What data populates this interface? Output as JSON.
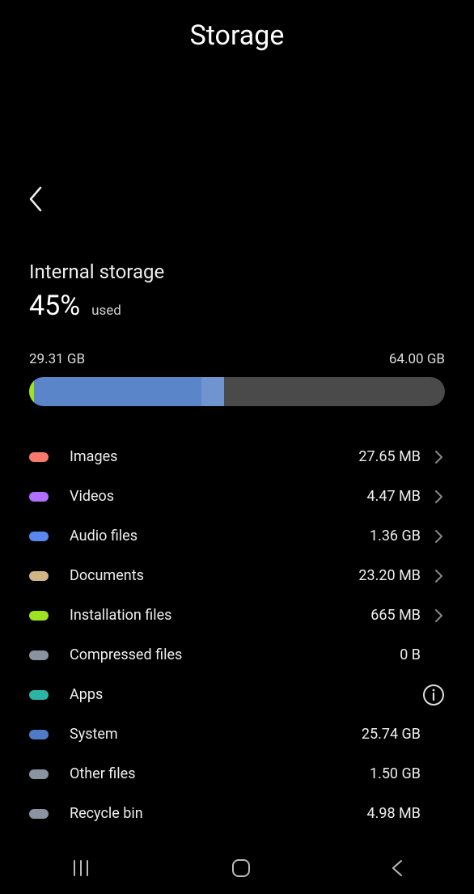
{
  "header": {
    "title": "Storage"
  },
  "storage": {
    "section_title": "Internal storage",
    "percent_value": "45%",
    "percent_label": "used",
    "used_size": "29.31 GB",
    "total_size": "64.00 GB",
    "used_percent": 45.8
  },
  "categories": [
    {
      "id": "images",
      "label": "Images",
      "size": "27.65 MB",
      "color": "#f77a6b",
      "bar_percent": 0.04,
      "chevron": true
    },
    {
      "id": "videos",
      "label": "Videos",
      "size": "4.47 MB",
      "color": "#b46eff",
      "bar_percent": 0.007,
      "chevron": true
    },
    {
      "id": "audio-files",
      "label": "Audio files",
      "size": "1.36 GB",
      "color": "#5a86f0",
      "bar_percent": 2.13,
      "chevron": true
    },
    {
      "id": "documents",
      "label": "Documents",
      "size": "23.20 MB",
      "color": "#d2b584",
      "bar_percent": 0.04,
      "chevron": true
    },
    {
      "id": "installation-files",
      "label": "Installation files",
      "size": "665 MB",
      "color": "#9fe221",
      "bar_percent": 1.04,
      "chevron": true
    },
    {
      "id": "compressed-files",
      "label": "Compressed files",
      "size": "0 B",
      "color": "#8a94a0",
      "bar_percent": 0,
      "chevron": false
    },
    {
      "id": "apps",
      "label": "Apps",
      "size": "",
      "color": "#2bb3a3",
      "bar_percent": 0,
      "info": true
    },
    {
      "id": "system",
      "label": "System",
      "size": "25.74 GB",
      "color": "#4f7ac8",
      "bar_percent": 40.2,
      "chevron": false
    },
    {
      "id": "other-files",
      "label": "Other files",
      "size": "1.50 GB",
      "color": "#8a94a0",
      "bar_percent": 2.34,
      "chevron": false
    },
    {
      "id": "recycle-bin",
      "label": "Recycle bin",
      "size": "4.98 MB",
      "color": "#8a94a0",
      "bar_percent": 0.008,
      "chevron": false
    }
  ],
  "colors": {
    "bar_bg": "#4a4a4a",
    "accent_edge": "#9fe221"
  }
}
